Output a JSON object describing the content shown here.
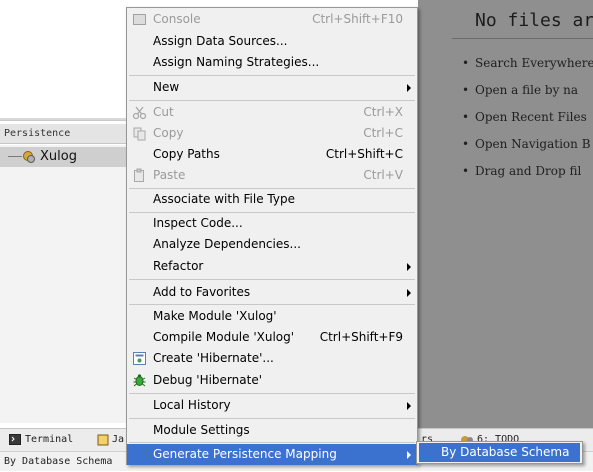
{
  "persistence_panel": {
    "header": "Persistence",
    "tree_item": "Xulog"
  },
  "editor": {
    "empty_title": "No files are",
    "hints": [
      "Search Everywhere",
      "Open a file by na",
      "Open Recent Files",
      "Open Navigation B",
      "Drag and Drop fil"
    ]
  },
  "bottom_tabs": {
    "terminal": "Terminal",
    "java": "Ja",
    "rs": "rs",
    "todo": "6: TODO"
  },
  "status_bar": {
    "text": "By Database Schema"
  },
  "context_menu": {
    "console": {
      "label": "Console",
      "shortcut": "Ctrl+Shift+F10"
    },
    "assign_data_sources": {
      "label": "Assign Data Sources..."
    },
    "assign_naming": {
      "label": "Assign Naming Strategies..."
    },
    "new": {
      "label": "New"
    },
    "cut": {
      "label": "Cut",
      "shortcut": "Ctrl+X"
    },
    "copy": {
      "label": "Copy",
      "shortcut": "Ctrl+C"
    },
    "copy_paths": {
      "label": "Copy Paths",
      "shortcut": "Ctrl+Shift+C"
    },
    "paste": {
      "label": "Paste",
      "shortcut": "Ctrl+V"
    },
    "associate": {
      "label": "Associate with File Type"
    },
    "inspect": {
      "label": "Inspect Code..."
    },
    "analyze": {
      "label": "Analyze Dependencies..."
    },
    "refactor": {
      "label": "Refactor"
    },
    "favorites": {
      "label": "Add to Favorites"
    },
    "make_module": {
      "label": "Make Module 'Xulog'"
    },
    "compile_module": {
      "label": "Compile Module 'Xulog'",
      "shortcut": "Ctrl+Shift+F9"
    },
    "create_hibernate": {
      "label": "Create 'Hibernate'..."
    },
    "debug_hibernate": {
      "label": "Debug 'Hibernate'"
    },
    "local_history": {
      "label": "Local History"
    },
    "module_settings": {
      "label": "Module Settings"
    },
    "generate_mapping": {
      "label": "Generate Persistence Mapping"
    }
  },
  "submenu": {
    "by_database_schema": "By Database Schema"
  },
  "colors": {
    "highlight": "#3b72cf",
    "menu_bg": "#f0f0f0",
    "editor_bg": "#8f8f8f",
    "disabled_text": "#9a9a9a"
  }
}
